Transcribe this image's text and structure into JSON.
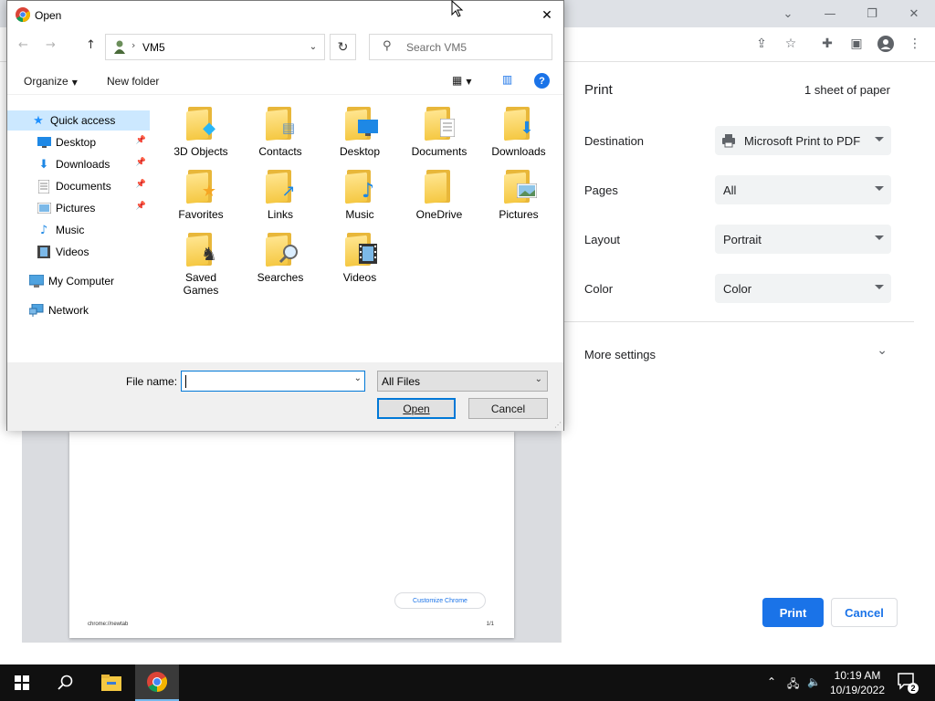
{
  "chrome": {
    "window_controls": {
      "tabs_dropdown": "⌄",
      "minimize": "—",
      "restore": "❐",
      "close": "✕"
    },
    "toolbar_icons": [
      "share-icon",
      "star-icon",
      "extensions-icon",
      "side-panel-icon",
      "profile-icon",
      "menu-icon"
    ]
  },
  "preview": {
    "page_url": "chrome://newtab",
    "page_num": "1/1",
    "customize_label": "Customize Chrome"
  },
  "print": {
    "title": "Print",
    "sheets": "1 sheet of paper",
    "destination_label": "Destination",
    "destination_value": "Microsoft Print to PDF",
    "pages_label": "Pages",
    "pages_value": "All",
    "layout_label": "Layout",
    "layout_value": "Portrait",
    "color_label": "Color",
    "color_value": "Color",
    "more_settings": "More settings",
    "print_button": "Print",
    "cancel_button": "Cancel",
    "accent_color": "#1a73e8"
  },
  "dialog": {
    "title": "Open",
    "address": {
      "location": "VM5"
    },
    "search_placeholder": "Search VM5",
    "organize": "Organize",
    "new_folder": "New folder",
    "nav_items": [
      {
        "label": "Quick access",
        "icon": "star-icon"
      },
      {
        "label": "Desktop",
        "icon": "desktop-icon"
      },
      {
        "label": "Downloads",
        "icon": "download-icon"
      },
      {
        "label": "Documents",
        "icon": "document-icon"
      },
      {
        "label": "Pictures",
        "icon": "pictures-icon"
      },
      {
        "label": "Music",
        "icon": "music-icon"
      },
      {
        "label": "Videos",
        "icon": "videos-icon"
      },
      {
        "label": "My Computer",
        "icon": "computer-icon"
      },
      {
        "label": "Network",
        "icon": "network-icon"
      }
    ],
    "files": [
      {
        "line1": "3D Objects",
        "line2": "",
        "icon": "cube-icon"
      },
      {
        "line1": "Contacts",
        "line2": "",
        "icon": "contact-card-icon"
      },
      {
        "line1": "Desktop",
        "line2": "",
        "icon": "monitor-icon"
      },
      {
        "line1": "Documents",
        "line2": "",
        "icon": "document-icon"
      },
      {
        "line1": "Downloads",
        "line2": "",
        "icon": "download-arrow-icon"
      },
      {
        "line1": "Favorites",
        "line2": "",
        "icon": "star-icon"
      },
      {
        "line1": "Links",
        "line2": "",
        "icon": "link-arrow-icon"
      },
      {
        "line1": "Music",
        "line2": "",
        "icon": "music-note-icon"
      },
      {
        "line1": "OneDrive",
        "line2": "",
        "icon": "folder-icon"
      },
      {
        "line1": "Pictures",
        "line2": "",
        "icon": "picture-icon"
      },
      {
        "line1": "Saved",
        "line2": "Games",
        "icon": "chess-piece-icon"
      },
      {
        "line1": "Searches",
        "line2": "",
        "icon": "magnifier-icon"
      },
      {
        "line1": "Videos",
        "line2": "",
        "icon": "film-icon"
      }
    ],
    "file_name_label": "File name:",
    "file_name_value": "",
    "filter_value": "All Files",
    "open_button": "Open",
    "cancel_button": "Cancel"
  },
  "taskbar": {
    "time": "10:19 AM",
    "date": "10/19/2022",
    "notification_count": "2"
  }
}
